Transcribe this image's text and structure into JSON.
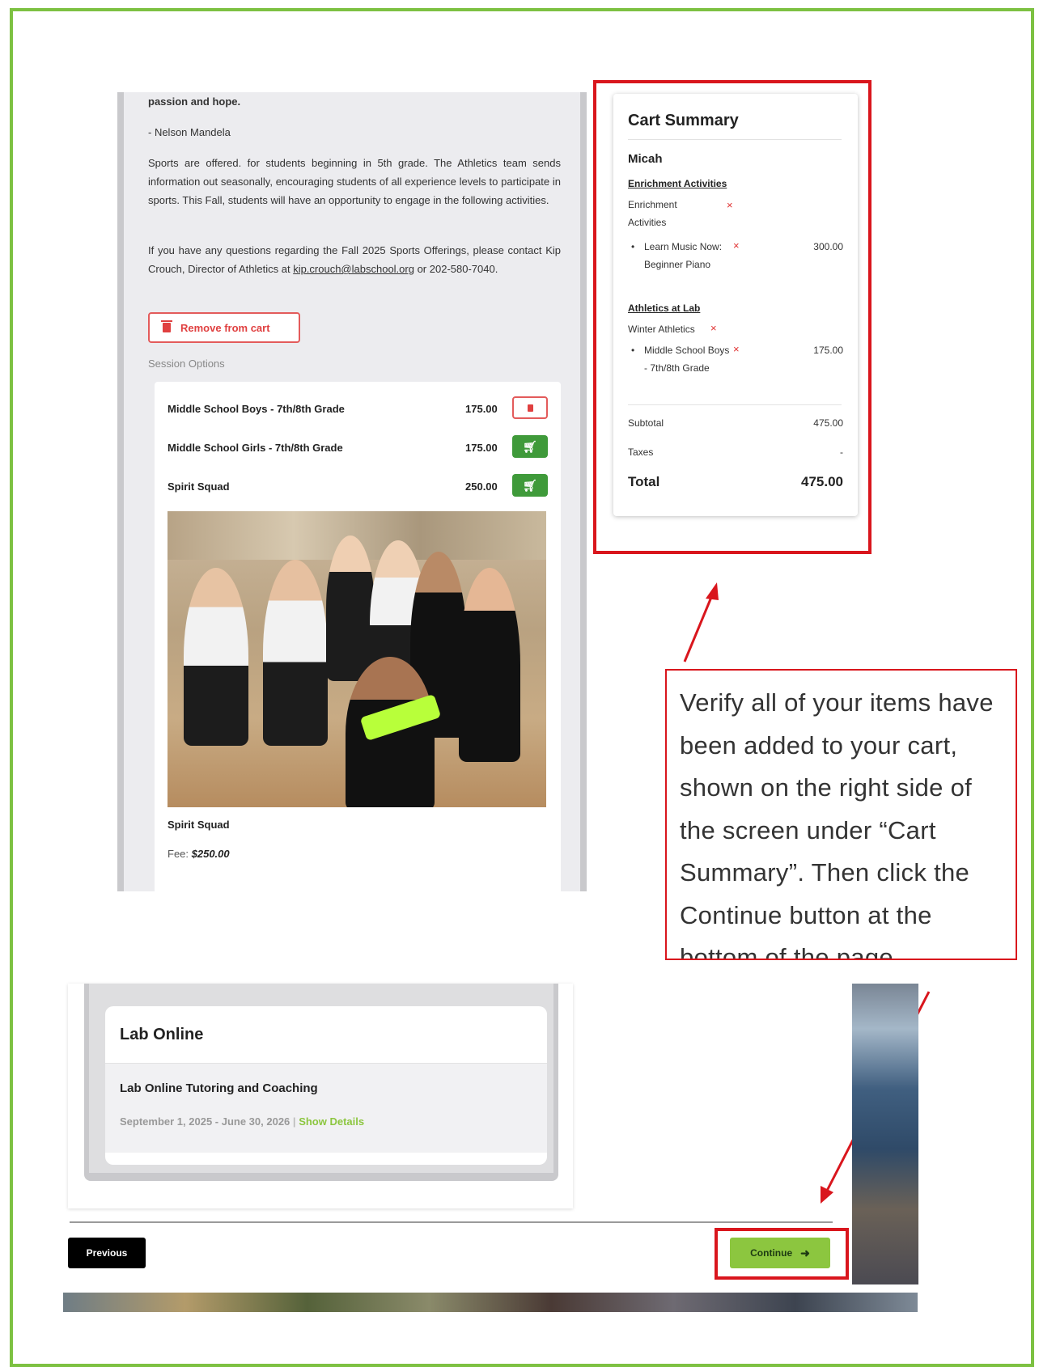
{
  "left_panel": {
    "quote_end": "passion and hope.",
    "quote_author": "- Nelson Mandela",
    "sports_paragraph": "Sports are offered. for students beginning in 5th grade. The Athletics team sends information out seasonally, encouraging students of all experience levels to participate in sports. This Fall, students will have an opportunity to engage in the following activities.",
    "contact_paragraph_before": "If you have any questions regarding the Fall 2025 Sports Offerings, please contact Kip Crouch, Director of Athletics at ",
    "contact_email": "kip.crouch@labschool.org",
    "contact_paragraph_after": " or 202-580-7040.",
    "remove_button_label": "Remove from cart",
    "session_options_label": "Session Options",
    "options": [
      {
        "name": "Middle School Boys - 7th/8th Grade",
        "price": "175.00",
        "action": "remove"
      },
      {
        "name": "Middle School Girls - 7th/8th Grade",
        "price": "175.00",
        "action": "add"
      },
      {
        "name": "Spirit Squad",
        "price": "250.00",
        "action": "add"
      }
    ],
    "photo_caption": "Spirit Squad",
    "fee_label": "Fee:",
    "fee_value": "$250.00"
  },
  "cart": {
    "title": "Cart Summary",
    "student": "Micah",
    "groups": [
      {
        "category": "Enrichment Activities",
        "sub": "Enrichment Activities",
        "item": "Learn Music Now: Beginner Piano",
        "amount": "300.00"
      },
      {
        "category": "Athletics at Lab",
        "sub": "Winter Athletics",
        "item": "Middle School Boys - 7th/8th Grade",
        "amount": "175.00"
      }
    ],
    "remove_glyph": "×",
    "subtotal_label": "Subtotal",
    "subtotal_value": "475.00",
    "taxes_label": "Taxes",
    "taxes_value": "-",
    "total_label": "Total",
    "total_value": "475.00"
  },
  "callout": {
    "text": "Verify all of your items have been added to your cart, shown on the right side of the screen under “Cart Summary”. Then click the Continue button at the bottom of the page"
  },
  "lower": {
    "section_title": "Lab Online",
    "course_title": "Lab Online Tutoring and Coaching",
    "dates": "September 1, 2025 - June 30, 2026",
    "separator": "|",
    "details_link": "Show Details"
  },
  "nav": {
    "previous_label": "Previous",
    "continue_label": "Continue",
    "continue_arrow": "➜"
  },
  "colors": {
    "frame_green": "#7dc142",
    "highlight_red": "#d9161d",
    "continue_green": "#8cc63f",
    "add_green": "#3f9a3a",
    "remove_red": "#e35b5b"
  }
}
